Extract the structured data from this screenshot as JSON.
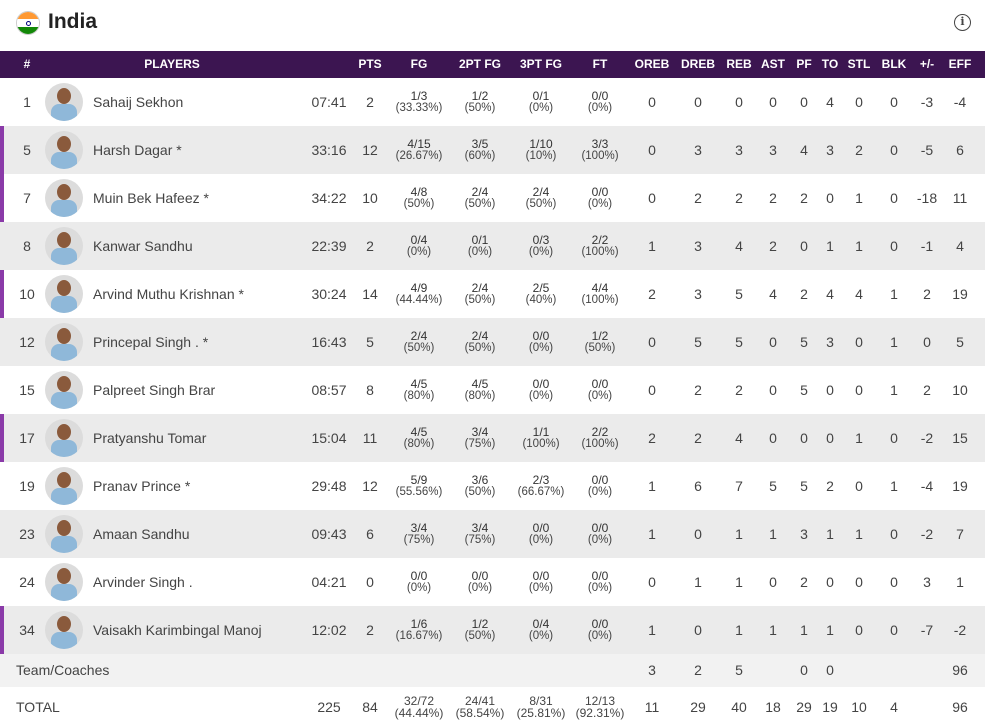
{
  "team": {
    "name": "India",
    "info_icon": "info-icon",
    "flag_icon": "india-flag-icon"
  },
  "columns": [
    "#",
    "PLAYERS",
    "PTS",
    "FG",
    "2PT FG",
    "3PT FG",
    "FT",
    "OREB",
    "DREB",
    "REB",
    "AST",
    "PF",
    "TO",
    "STL",
    "BLK",
    "+/-",
    "EFF"
  ],
  "players": [
    {
      "num": "1",
      "name": "Sahaij Sekhon",
      "starter": false,
      "min": "07:41",
      "pts": "2",
      "fg": "1/3",
      "fg_pct": "(33.33%)",
      "fg2": "1/2",
      "fg2_pct": "(50%)",
      "fg3": "0/1",
      "fg3_pct": "(0%)",
      "ft": "0/0",
      "ft_pct": "(0%)",
      "oreb": "0",
      "dreb": "0",
      "reb": "0",
      "ast": "0",
      "pf": "0",
      "to": "4",
      "stl": "0",
      "blk": "0",
      "pm": "-3",
      "eff": "-4"
    },
    {
      "num": "5",
      "name": "Harsh Dagar",
      "starter": true,
      "min": "33:16",
      "pts": "12",
      "fg": "4/15",
      "fg_pct": "(26.67%)",
      "fg2": "3/5",
      "fg2_pct": "(60%)",
      "fg3": "1/10",
      "fg3_pct": "(10%)",
      "ft": "3/3",
      "ft_pct": "(100%)",
      "oreb": "0",
      "dreb": "3",
      "reb": "3",
      "ast": "3",
      "pf": "4",
      "to": "3",
      "stl": "2",
      "blk": "0",
      "pm": "-5",
      "eff": "6"
    },
    {
      "num": "7",
      "name": "Muin Bek Hafeez",
      "starter": true,
      "min": "34:22",
      "pts": "10",
      "fg": "4/8",
      "fg_pct": "(50%)",
      "fg2": "2/4",
      "fg2_pct": "(50%)",
      "fg3": "2/4",
      "fg3_pct": "(50%)",
      "ft": "0/0",
      "ft_pct": "(0%)",
      "oreb": "0",
      "dreb": "2",
      "reb": "2",
      "ast": "2",
      "pf": "2",
      "to": "0",
      "stl": "1",
      "blk": "0",
      "pm": "-18",
      "eff": "11"
    },
    {
      "num": "8",
      "name": "Kanwar Sandhu",
      "starter": false,
      "min": "22:39",
      "pts": "2",
      "fg": "0/4",
      "fg_pct": "(0%)",
      "fg2": "0/1",
      "fg2_pct": "(0%)",
      "fg3": "0/3",
      "fg3_pct": "(0%)",
      "ft": "2/2",
      "ft_pct": "(100%)",
      "oreb": "1",
      "dreb": "3",
      "reb": "4",
      "ast": "2",
      "pf": "0",
      "to": "1",
      "stl": "1",
      "blk": "0",
      "pm": "-1",
      "eff": "4"
    },
    {
      "num": "10",
      "name": "Arvind Muthu Krishnan",
      "starter": true,
      "min": "30:24",
      "pts": "14",
      "fg": "4/9",
      "fg_pct": "(44.44%)",
      "fg2": "2/4",
      "fg2_pct": "(50%)",
      "fg3": "2/5",
      "fg3_pct": "(40%)",
      "ft": "4/4",
      "ft_pct": "(100%)",
      "oreb": "2",
      "dreb": "3",
      "reb": "5",
      "ast": "4",
      "pf": "2",
      "to": "4",
      "stl": "4",
      "blk": "1",
      "pm": "2",
      "eff": "19"
    },
    {
      "num": "12",
      "name": "Princepal Singh .",
      "starter": true,
      "min": "16:43",
      "pts": "5",
      "fg": "2/4",
      "fg_pct": "(50%)",
      "fg2": "2/4",
      "fg2_pct": "(50%)",
      "fg3": "0/0",
      "fg3_pct": "(0%)",
      "ft": "1/2",
      "ft_pct": "(50%)",
      "oreb": "0",
      "dreb": "5",
      "reb": "5",
      "ast": "0",
      "pf": "5",
      "to": "3",
      "stl": "0",
      "blk": "1",
      "pm": "0",
      "eff": "5"
    },
    {
      "num": "15",
      "name": "Palpreet Singh Brar",
      "starter": false,
      "min": "08:57",
      "pts": "8",
      "fg": "4/5",
      "fg_pct": "(80%)",
      "fg2": "4/5",
      "fg2_pct": "(80%)",
      "fg3": "0/0",
      "fg3_pct": "(0%)",
      "ft": "0/0",
      "ft_pct": "(0%)",
      "oreb": "0",
      "dreb": "2",
      "reb": "2",
      "ast": "0",
      "pf": "5",
      "to": "0",
      "stl": "0",
      "blk": "1",
      "pm": "2",
      "eff": "10"
    },
    {
      "num": "17",
      "name": "Pratyanshu Tomar",
      "starter": false,
      "min": "15:04",
      "pts": "11",
      "fg": "4/5",
      "fg_pct": "(80%)",
      "fg2": "3/4",
      "fg2_pct": "(75%)",
      "fg3": "1/1",
      "fg3_pct": "(100%)",
      "ft": "2/2",
      "ft_pct": "(100%)",
      "oreb": "2",
      "dreb": "2",
      "reb": "4",
      "ast": "0",
      "pf": "0",
      "to": "0",
      "stl": "1",
      "blk": "0",
      "pm": "-2",
      "eff": "15"
    },
    {
      "num": "19",
      "name": "Pranav Prince",
      "starter": true,
      "min": "29:48",
      "pts": "12",
      "fg": "5/9",
      "fg_pct": "(55.56%)",
      "fg2": "3/6",
      "fg2_pct": "(50%)",
      "fg3": "2/3",
      "fg3_pct": "(66.67%)",
      "ft": "0/0",
      "ft_pct": "(0%)",
      "oreb": "1",
      "dreb": "6",
      "reb": "7",
      "ast": "5",
      "pf": "5",
      "to": "2",
      "stl": "0",
      "blk": "1",
      "pm": "-4",
      "eff": "19"
    },
    {
      "num": "23",
      "name": "Amaan Sandhu",
      "starter": false,
      "min": "09:43",
      "pts": "6",
      "fg": "3/4",
      "fg_pct": "(75%)",
      "fg2": "3/4",
      "fg2_pct": "(75%)",
      "fg3": "0/0",
      "fg3_pct": "(0%)",
      "ft": "0/0",
      "ft_pct": "(0%)",
      "oreb": "1",
      "dreb": "0",
      "reb": "1",
      "ast": "1",
      "pf": "3",
      "to": "1",
      "stl": "1",
      "blk": "0",
      "pm": "-2",
      "eff": "7"
    },
    {
      "num": "24",
      "name": "Arvinder Singh .",
      "starter": false,
      "min": "04:21",
      "pts": "0",
      "fg": "0/0",
      "fg_pct": "(0%)",
      "fg2": "0/0",
      "fg2_pct": "(0%)",
      "fg3": "0/0",
      "fg3_pct": "(0%)",
      "ft": "0/0",
      "ft_pct": "(0%)",
      "oreb": "0",
      "dreb": "1",
      "reb": "1",
      "ast": "0",
      "pf": "2",
      "to": "0",
      "stl": "0",
      "blk": "0",
      "pm": "3",
      "eff": "1"
    },
    {
      "num": "34",
      "name": "Vaisakh Karimbingal Manoj",
      "starter": false,
      "min": "12:02",
      "pts": "2",
      "fg": "1/6",
      "fg_pct": "(16.67%)",
      "fg2": "1/2",
      "fg2_pct": "(50%)",
      "fg3": "0/4",
      "fg3_pct": "(0%)",
      "ft": "0/0",
      "ft_pct": "(0%)",
      "oreb": "1",
      "dreb": "0",
      "reb": "1",
      "ast": "1",
      "pf": "1",
      "to": "1",
      "stl": "0",
      "blk": "0",
      "pm": "-7",
      "eff": "-2"
    }
  ],
  "marked_rows": [
    "5",
    "7",
    "10",
    "17",
    "34"
  ],
  "team_coaches": {
    "label": "Team/Coaches",
    "oreb": "3",
    "dreb": "2",
    "reb": "5",
    "pf": "0",
    "to": "0",
    "eff": "96"
  },
  "total": {
    "label": "TOTAL",
    "min": "225",
    "pts": "84",
    "fg": "32/72",
    "fg_pct": "(44.44%)",
    "fg2": "24/41",
    "fg2_pct": "(58.54%)",
    "fg3": "8/31",
    "fg3_pct": "(25.81%)",
    "ft": "12/13",
    "ft_pct": "(92.31%)",
    "oreb": "11",
    "dreb": "29",
    "reb": "40",
    "ast": "18",
    "pf": "29",
    "to": "19",
    "stl": "10",
    "blk": "4",
    "eff": "96"
  },
  "colors": {
    "header_bg": "#3c1551",
    "row_alt": "#ebebeb",
    "row_mark": "#8a3aa8"
  }
}
